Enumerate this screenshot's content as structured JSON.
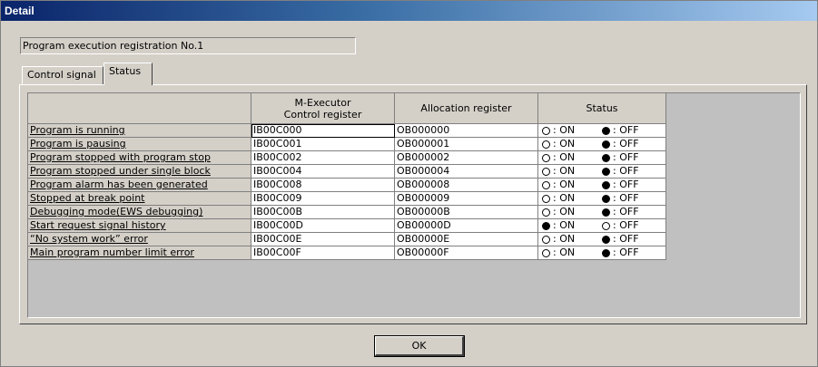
{
  "window": {
    "title": "Detail"
  },
  "program_line": "Program execution registration No.1",
  "tabs": [
    {
      "label": "Control signal",
      "active": false
    },
    {
      "label": "Status",
      "active": true
    }
  ],
  "table": {
    "headers": [
      "M-Executor\nControl register",
      "Allocation register",
      "Status"
    ],
    "rows": [
      {
        "label": "Program is running",
        "control": "IB00C000",
        "alloc": "OB000000",
        "on_filled": false
      },
      {
        "label": "Program is pausing",
        "control": "IB00C001",
        "alloc": "OB000001",
        "on_filled": false
      },
      {
        "label": "Program stopped with program stop",
        "control": "IB00C002",
        "alloc": "OB000002",
        "on_filled": false
      },
      {
        "label": "Program stopped under single block",
        "control": "IB00C004",
        "alloc": "OB000004",
        "on_filled": false
      },
      {
        "label": "Program alarm has been generated",
        "control": "IB00C008",
        "alloc": "OB000008",
        "on_filled": false
      },
      {
        "label": "Stopped at break point",
        "control": "IB00C009",
        "alloc": "OB000009",
        "on_filled": false
      },
      {
        "label": "Debugging mode(EWS debugging)",
        "control": "IB00C00B",
        "alloc": "OB00000B",
        "on_filled": false
      },
      {
        "label": "Start request signal history",
        "control": "IB00C00D",
        "alloc": "OB00000D",
        "on_filled": true
      },
      {
        "label": "“No system work” error",
        "control": "IB00C00E",
        "alloc": "OB00000E",
        "on_filled": false
      },
      {
        "label": "Main program number limit error",
        "control": "IB00C00F",
        "alloc": "OB00000F",
        "on_filled": false
      }
    ],
    "on_text": ": ON",
    "off_text": ": OFF",
    "selected_row": 0
  },
  "ok_label": "OK"
}
